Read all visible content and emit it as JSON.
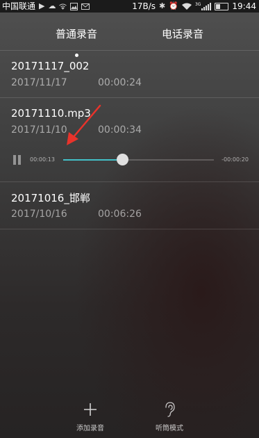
{
  "status_bar": {
    "carrier": "中国联通",
    "speed": "17B/s",
    "network": "3G",
    "time": "19:44"
  },
  "tabs": [
    {
      "label": "普通录音",
      "active": true
    },
    {
      "label": "电话录音",
      "active": false
    }
  ],
  "recordings": [
    {
      "title": "20171117_002",
      "date": "2017/11/17",
      "duration": "00:00:24"
    },
    {
      "title": "20171110.mp3",
      "date": "2017/11/10",
      "duration": "00:00:34"
    },
    {
      "title": "20171016_邯郸",
      "date": "2017/10/16",
      "duration": "00:06:26"
    }
  ],
  "player": {
    "elapsed": "00:00:13",
    "remaining": "-00:00:20",
    "progress_fraction": 0.39,
    "accent_color": "#43c1c8"
  },
  "annotation": {
    "color": "#e8332b"
  },
  "bottom_bar": {
    "add_label": "添加录音",
    "earpiece_label": "听筒模式"
  }
}
